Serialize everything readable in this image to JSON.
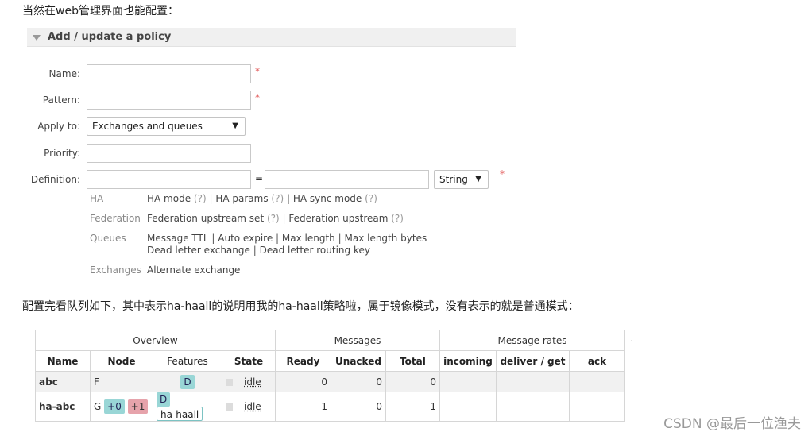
{
  "intro_text": "当然在web管理界面也能配置：",
  "panel": {
    "title": "Add / update a policy"
  },
  "form": {
    "name_label": "Name:",
    "pattern_label": "Pattern:",
    "apply_label": "Apply to:",
    "apply_value": "Exchanges and queues",
    "priority_label": "Priority:",
    "definition_label": "Definition:",
    "equals": "=",
    "type_value": "String",
    "required_mark": "*"
  },
  "help": {
    "ha_label": "HA",
    "ha_items": [
      "HA mode",
      "HA params",
      "HA sync mode"
    ],
    "federation_label": "Federation",
    "federation_items": [
      "Federation upstream set",
      "Federation upstream"
    ],
    "queues_label": "Queues",
    "queues_line1": [
      "Message TTL",
      "Auto expire",
      "Max length",
      "Max length bytes"
    ],
    "queues_line2": [
      "Dead letter exchange",
      "Dead letter routing key"
    ],
    "exchanges_label": "Exchanges",
    "exchanges_item": "Alternate exchange",
    "q_mark": "(?)",
    "separator": "|"
  },
  "mid_text": "配置完看队列如下，其中表示ha-haall的说明用我的ha-haall策略啦，属于镜像模式，没有表示的就是普通模式：",
  "table": {
    "groups": [
      "Overview",
      "Messages",
      "Message rates"
    ],
    "headers": [
      "Name",
      "Node",
      "Features",
      "State",
      "Ready",
      "Unacked",
      "Total",
      "incoming",
      "deliver / get",
      "ack"
    ],
    "rows": [
      {
        "name": "abc",
        "node": "F",
        "node_tags": [],
        "features": [
          "D"
        ],
        "policy": "",
        "state": "idle",
        "ready": "0",
        "unacked": "0",
        "total": "0"
      },
      {
        "name": "ha-abc",
        "node": "G",
        "node_tags": [
          "+0",
          "+1"
        ],
        "features": [
          "D"
        ],
        "policy": "ha-haall",
        "state": "idle",
        "ready": "1",
        "unacked": "0",
        "total": "1"
      }
    ]
  },
  "stray_dot": ".",
  "watermark": "CSDN @最后一位渔夫"
}
